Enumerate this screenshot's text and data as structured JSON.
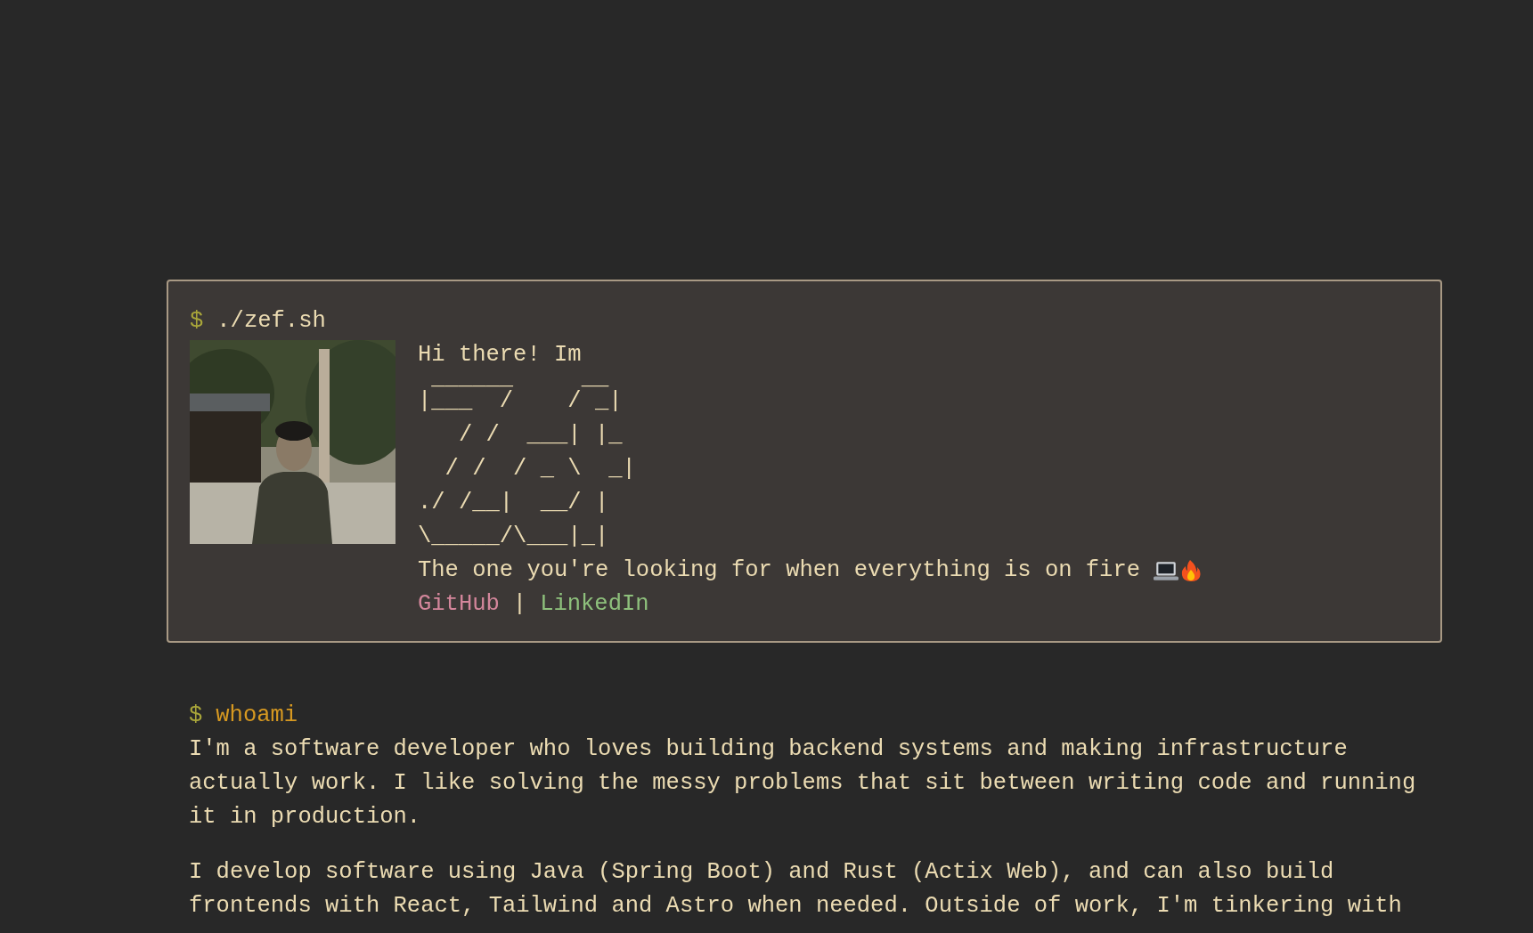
{
  "intro_card": {
    "prompt_symbol": "$",
    "command": "./zef.sh",
    "greeting": "Hi there! Im",
    "ascii_art": [
      " ______     __",
      "|___  /    / _|",
      "   / /  ___| |_",
      "  / /  / _ \\  _|",
      "./ /__|  __/ |",
      "\\_____/\\___|_|"
    ],
    "tagline": "The one you're looking for when everything is on fire",
    "links": [
      {
        "label": "GitHub",
        "color": "#d3869b"
      },
      {
        "label": "LinkedIn",
        "color": "#8ec07c"
      }
    ],
    "link_separator": "|"
  },
  "whoami": {
    "prompt_symbol": "$",
    "command": "whoami",
    "paragraphs": [
      "I'm a software developer who loves building backend systems and making infrastructure actually work. I like solving the messy problems that sit between writing code and running it in production.",
      "I develop software using Java (Spring Boot) and Rust (Actix Web), and can also build frontends with React, Tailwind and Astro when needed. Outside of work, I'm tinkering with"
    ]
  }
}
